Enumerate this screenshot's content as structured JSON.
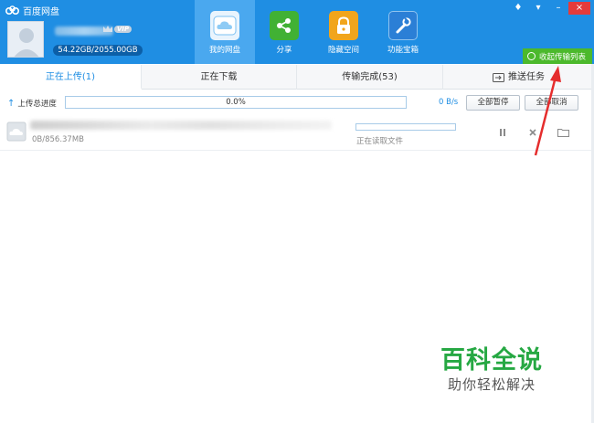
{
  "app": {
    "title": "百度网盘"
  },
  "window_controls": {
    "skin": "♦",
    "menu": "▾",
    "minimize": "–",
    "close": "×"
  },
  "user": {
    "vip": "VIP",
    "quota": "54.22GB/2055.00GB"
  },
  "nav": [
    {
      "label": "我的网盘",
      "icon": "cloud-icon",
      "active": true,
      "color": "#ffffff"
    },
    {
      "label": "分享",
      "icon": "share-icon",
      "active": false,
      "color": "#41b134"
    },
    {
      "label": "隐藏空间",
      "icon": "lock-icon",
      "active": false,
      "color": "#f1a51c"
    },
    {
      "label": "功能宝箱",
      "icon": "tools-icon",
      "active": false,
      "color": "#2b7fd6"
    }
  ],
  "collapse_button": {
    "label": "收起传输列表"
  },
  "tabs": [
    {
      "label": "正在上传(1)",
      "active": true
    },
    {
      "label": "正在下载",
      "active": false
    },
    {
      "label": "传输完成(53)",
      "active": false
    },
    {
      "label": "推送任务",
      "active": false
    }
  ],
  "upload_progress": {
    "label": "上传总进度",
    "percent_text": "0.0%",
    "progress": 0.0,
    "speed": "0 B/s",
    "pause_all": "全部暂停",
    "cancel_all": "全部取消"
  },
  "tasks": [
    {
      "size": "0B/856.37MB",
      "status": "正在读取文件",
      "progress": 0.0
    }
  ],
  "watermark": {
    "title": "百科全说",
    "subtitle": "助你轻松解决"
  },
  "colors": {
    "brand": "#1f8ee3",
    "active_nav": "#4aa8ef",
    "collapse": "#4cb92c",
    "annotation": "#e52d2d"
  }
}
